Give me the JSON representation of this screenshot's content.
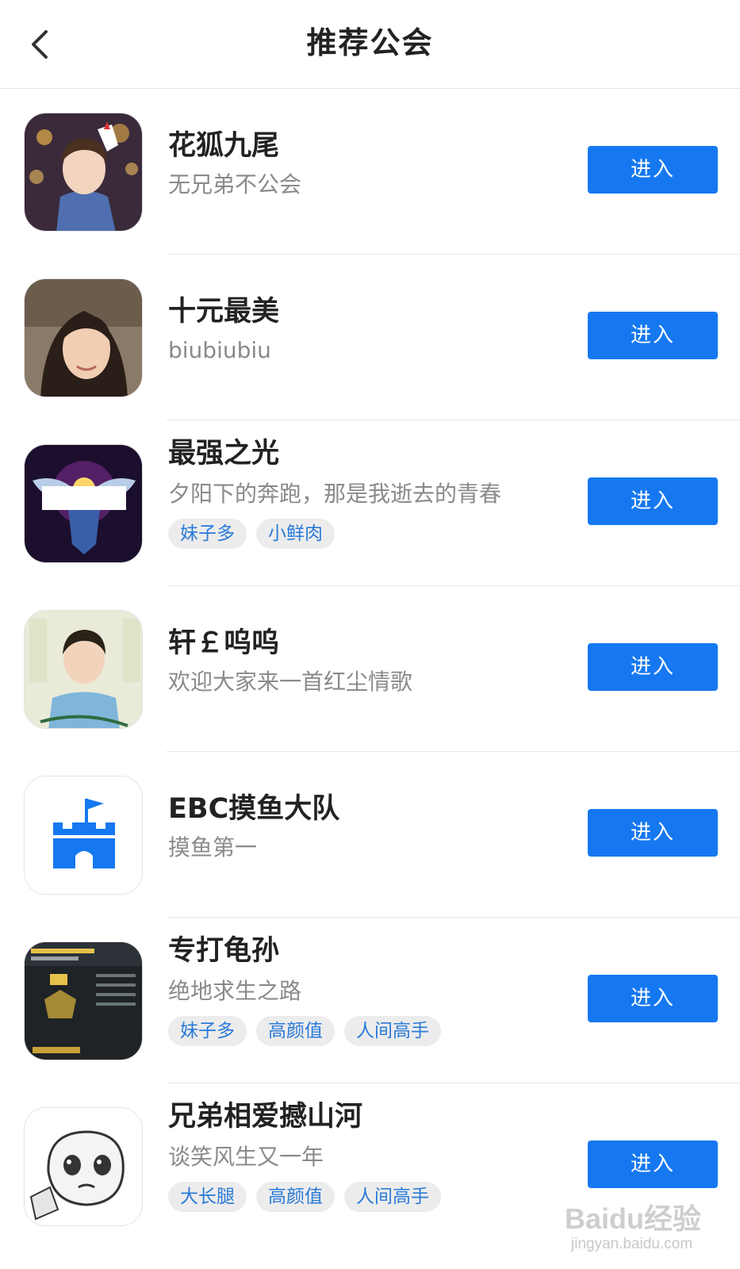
{
  "header": {
    "title": "推荐公会",
    "back_icon": "chevron-left-icon"
  },
  "guilds": [
    {
      "name": "花狐九尾",
      "desc": "无兄弟不公会",
      "tags": [],
      "button": "进入",
      "avatar": "anime-character-avatar"
    },
    {
      "name": "十元最美",
      "desc": "biubiubiu",
      "tags": [],
      "button": "进入",
      "avatar": "portrait-photo-avatar"
    },
    {
      "name": "最强之光",
      "desc": "夕阳下的奔跑，那是我逝去的青春",
      "tags": [
        "妹子多",
        "小鲜肉"
      ],
      "button": "进入",
      "avatar": "winged-emblem-avatar"
    },
    {
      "name": "轩￡呜呜",
      "desc": "欢迎大家来一首红尘情歌",
      "tags": [],
      "button": "进入",
      "avatar": "young-man-photo-avatar"
    },
    {
      "name": "EBC摸鱼大队",
      "desc": "摸鱼第一",
      "tags": [],
      "button": "进入",
      "avatar": "castle-flag-icon"
    },
    {
      "name": "专打龟孙",
      "desc": "绝地求生之路",
      "tags": [
        "妹子多",
        "高颜值",
        "人间高手"
      ],
      "button": "进入",
      "avatar": "game-stats-screenshot-avatar"
    },
    {
      "name": "兄弟相爱撼山河",
      "desc": "谈笑风生又一年",
      "tags": [
        "大长腿",
        "高颜值",
        "人间高手"
      ],
      "button": "进入",
      "avatar": "meme-face-avatar"
    }
  ],
  "watermark": {
    "brand": "Baidu经验",
    "url": "jingyan.baidu.com"
  },
  "colors": {
    "accent": "#1678f0",
    "tag_text": "#2a7ad8",
    "tag_bg": "#ececec"
  }
}
